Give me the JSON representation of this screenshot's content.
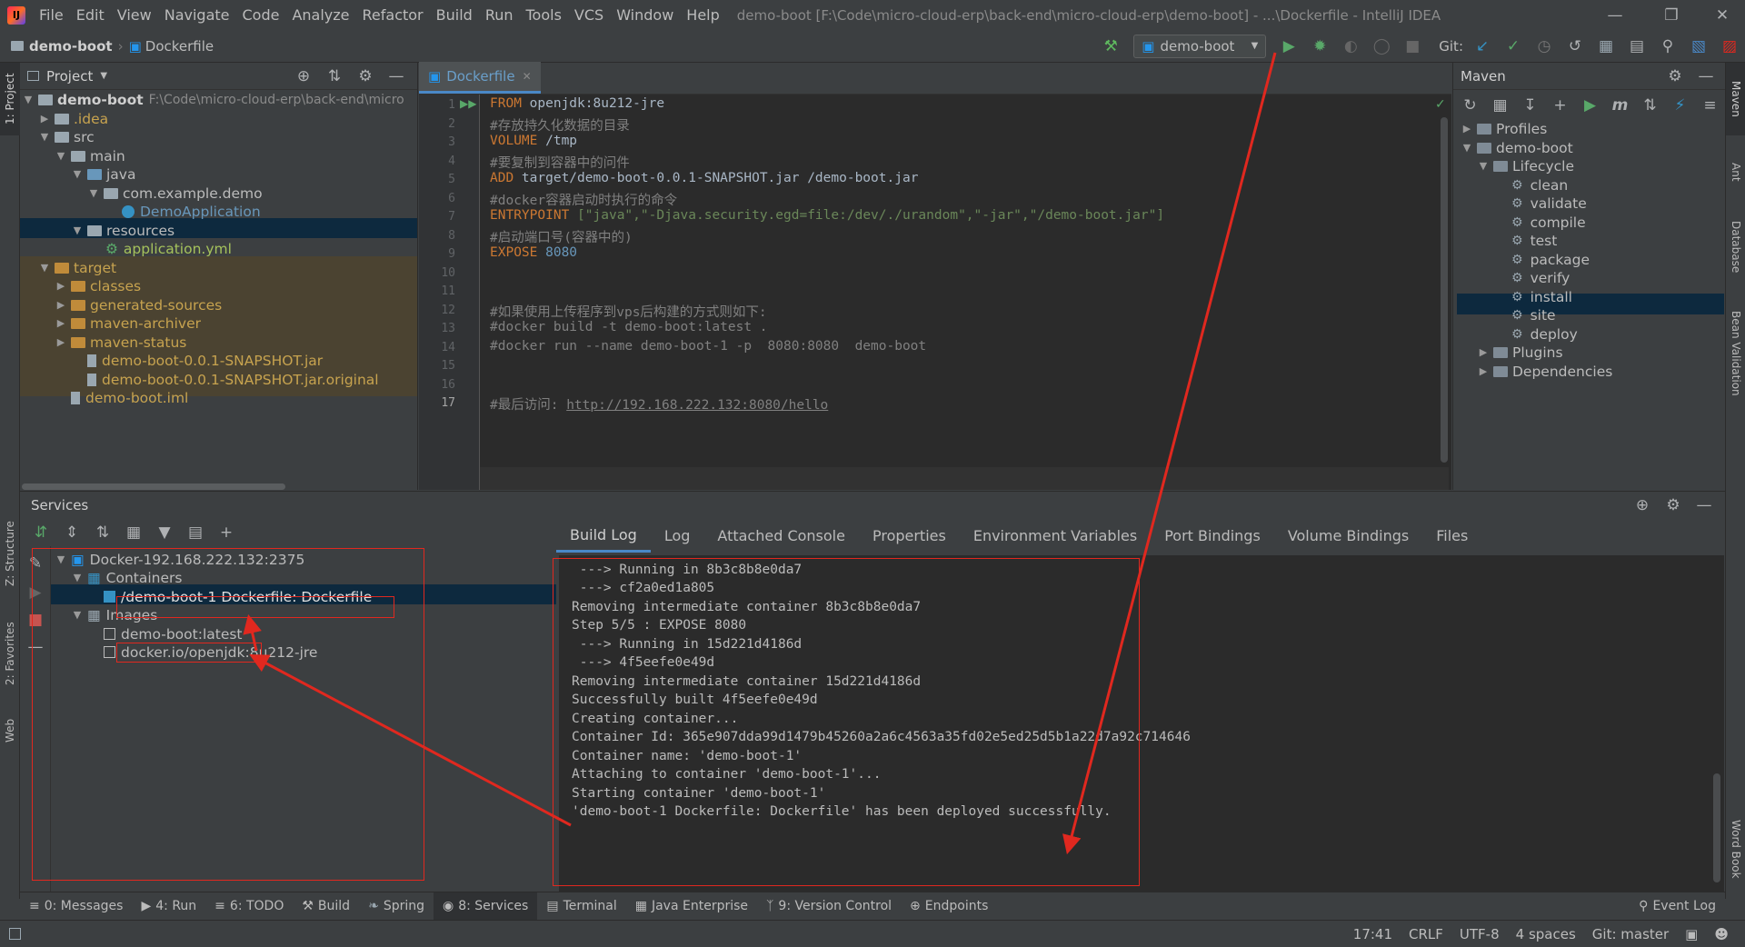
{
  "menubar": {
    "items": [
      "File",
      "Edit",
      "View",
      "Navigate",
      "Code",
      "Analyze",
      "Refactor",
      "Build",
      "Run",
      "Tools",
      "VCS",
      "Window",
      "Help"
    ],
    "title": "demo-boot [F:\\Code\\micro-cloud-erp\\back-end\\micro-cloud-erp\\demo-boot] - ...\\Dockerfile - IntelliJ IDEA"
  },
  "navbar": {
    "crumb_project": "demo-boot",
    "crumb_file": "Dockerfile",
    "run_config": "demo-boot",
    "git_label": "Git:"
  },
  "left_strip": {
    "project": "1: Project",
    "structure": "Z: Structure",
    "favorites": "2: Favorites",
    "web": "Web"
  },
  "right_strip": {
    "maven": "Maven",
    "ant": "Ant",
    "database": "Database",
    "bean": "Bean Validation",
    "word": "Word Book"
  },
  "project": {
    "header": "Project",
    "root_name": "demo-boot",
    "root_path": "F:\\Code\\micro-cloud-erp\\back-end\\micro",
    "items": [
      {
        "label": ".idea"
      },
      {
        "label": "src"
      },
      {
        "label": "main"
      },
      {
        "label": "java"
      },
      {
        "label": "com.example.demo"
      },
      {
        "label": "DemoApplication"
      },
      {
        "label": "resources"
      },
      {
        "label": "application.yml"
      },
      {
        "label": "target"
      },
      {
        "label": "classes"
      },
      {
        "label": "generated-sources"
      },
      {
        "label": "maven-archiver"
      },
      {
        "label": "maven-status"
      },
      {
        "label": "demo-boot-0.0.1-SNAPSHOT.jar"
      },
      {
        "label": "demo-boot-0.0.1-SNAPSHOT.jar.original"
      },
      {
        "label": "demo-boot.iml"
      }
    ]
  },
  "editor": {
    "tab": "Dockerfile",
    "line_numbers": [
      "1",
      "2",
      "3",
      "4",
      "5",
      "6",
      "7",
      "8",
      "9",
      "10",
      "11",
      "12",
      "13",
      "14",
      "15",
      "16",
      "17"
    ],
    "lines": {
      "l1_kw": "FROM",
      "l1_rest": " openjdk:8u212-jre",
      "l2": "#存放持久化数据的目录",
      "l3_kw": "VOLUME",
      "l3_rest": " /tmp",
      "l4": "#要复制到容器中的问件",
      "l5_kw": "ADD",
      "l5_rest": " target/demo-boot-0.0.1-SNAPSHOT.jar /demo-boot.jar",
      "l6": "#docker容器启动时执行的命令",
      "l7_kw": "ENTRYPOINT",
      "l7_rest": " [\"java\",\"-Djava.security.egd=file:/dev/./urandom\",\"-jar\",\"/demo-boot.jar\"]",
      "l8": "#启动端口号(容器中的)",
      "l9_kw": "EXPOSE",
      "l9_num": " 8080",
      "l12": "#如果使用上传程序到vps后构建的方式则如下:",
      "l13": "#docker build -t demo-boot:latest .",
      "l14": "#docker run --name demo-boot-1 -p  8080:8080  demo-boot",
      "l17_pre": "#最后访问: ",
      "l17_url": "http://192.168.222.132:8080/hello"
    }
  },
  "maven": {
    "header": "Maven",
    "profiles": "Profiles",
    "project": "demo-boot",
    "lifecycle": "Lifecycle",
    "phases": [
      "clean",
      "validate",
      "compile",
      "test",
      "package",
      "verify",
      "install",
      "site",
      "deploy"
    ],
    "plugins": "Plugins",
    "dependencies": "Dependencies"
  },
  "services": {
    "header": "Services",
    "docker": "Docker-192.168.222.132:2375",
    "containers": "Containers",
    "container_item": "/demo-boot-1 Dockerfile: Dockerfile",
    "images": "Images",
    "image1": "demo-boot:latest",
    "image2": "docker.io/openjdk:8u212-jre",
    "tabs": [
      "Build Log",
      "Log",
      "Attached Console",
      "Properties",
      "Environment Variables",
      "Port Bindings",
      "Volume Bindings",
      "Files"
    ],
    "log": [
      " ---> Running in 8b3c8b8e0da7",
      " ---> cf2a0ed1a805",
      "Removing intermediate container 8b3c8b8e0da7",
      "Step 5/5 : EXPOSE 8080",
      " ---> Running in 15d221d4186d",
      " ---> 4f5eefe0e49d",
      "Removing intermediate container 15d221d4186d",
      "Successfully built 4f5eefe0e49d",
      "Creating container...",
      "Container Id: 365e907dda99d1479b45260a2a6c4563a35fd02e5ed25d5b1a22d7a92c714646",
      "Container name: 'demo-boot-1'",
      "Attaching to container 'demo-boot-1'...",
      "Starting container 'demo-boot-1'",
      "'demo-boot-1 Dockerfile: Dockerfile' has been deployed successfully."
    ]
  },
  "bottom_tabs": [
    "0: Messages",
    "4: Run",
    "6: TODO",
    "Build",
    "Spring",
    "8: Services",
    "Terminal",
    "Java Enterprise",
    "9: Version Control",
    "Endpoints"
  ],
  "event_log": "Event Log",
  "status": {
    "pos": "17:41",
    "eol": "CRLF",
    "enc": "UTF-8",
    "indent": "4 spaces",
    "git": "Git: master"
  },
  "colors": {
    "accent": "#4a88c7",
    "annotation": "#e0281f",
    "selection": "#0d293e"
  }
}
